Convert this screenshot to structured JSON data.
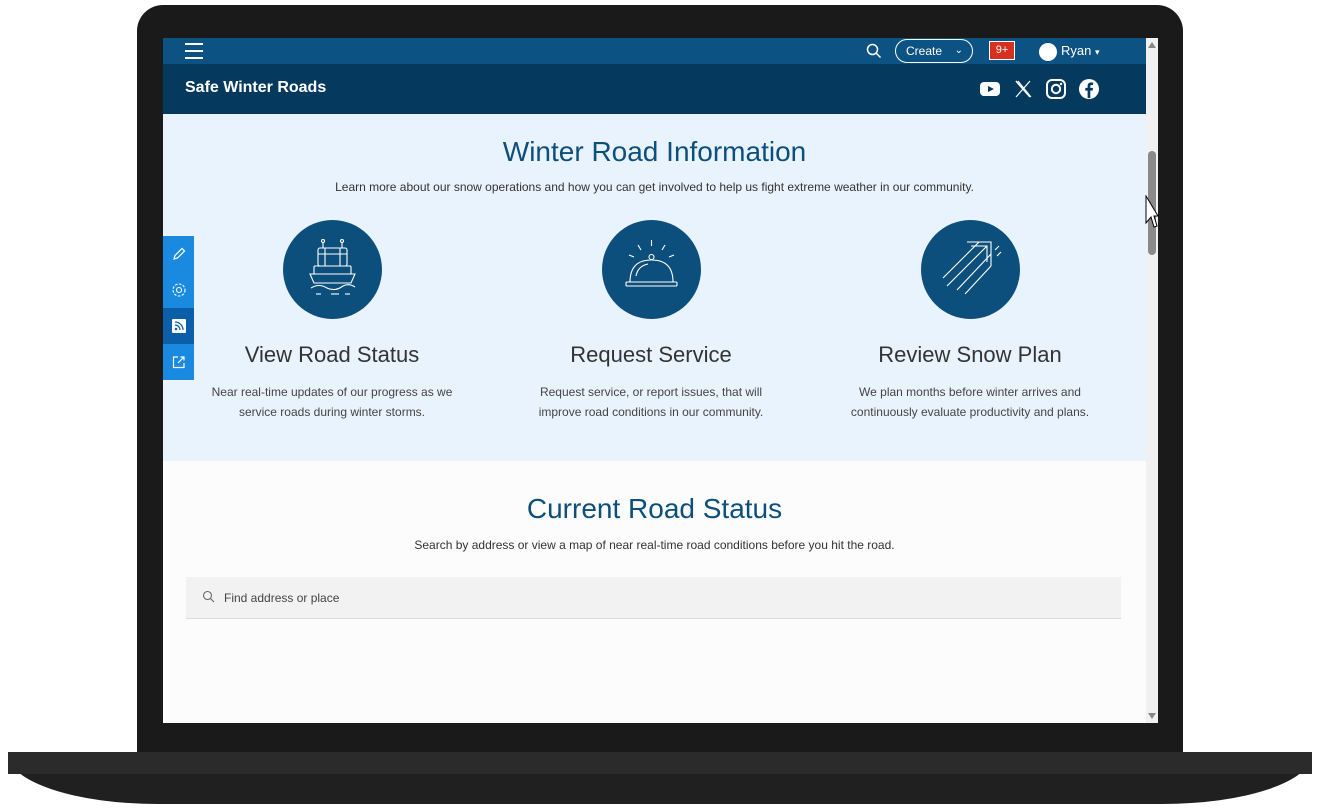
{
  "topbar": {
    "create_label": "Create",
    "notifications_badge": "9+",
    "user_name": "Ryan"
  },
  "site": {
    "title": "Safe Winter Roads",
    "social_icons": [
      "youtube-icon",
      "x-icon",
      "instagram-icon",
      "facebook-icon"
    ]
  },
  "info": {
    "title": "Winter Road Information",
    "subtitle": "Learn more about our snow operations and how you can get involved to help us fight extreme weather in our community.",
    "cards": [
      {
        "icon": "snowplow-icon",
        "title": "View Road Status",
        "line1": "Near real-time updates of our progress as we",
        "line2": "service roads during winter storms."
      },
      {
        "icon": "service-bell-icon",
        "title": "Request Service",
        "line1": "Request service, or report issues, that will",
        "line2": "improve road conditions in our community."
      },
      {
        "icon": "plan-arrow-icon",
        "title": "Review Snow Plan",
        "line1": "We plan months before winter arrives and",
        "line2": "continuously evaluate productivity and plans."
      }
    ]
  },
  "side_toolbar": [
    "edit-icon",
    "settings-icon",
    "rss-icon",
    "share-icon"
  ],
  "status": {
    "title": "Current Road Status",
    "subtitle": "Search by address or view a map of near real-time road conditions before you hit the road.",
    "search_placeholder": "Find address or place"
  },
  "colors": {
    "topbar": "#0c5282",
    "titlebar": "#053a5e",
    "accent": "#0c4f7c",
    "info_bg": "#e9f3fd",
    "side_toolbar": "#1a8ae0",
    "badge": "#d83020"
  }
}
